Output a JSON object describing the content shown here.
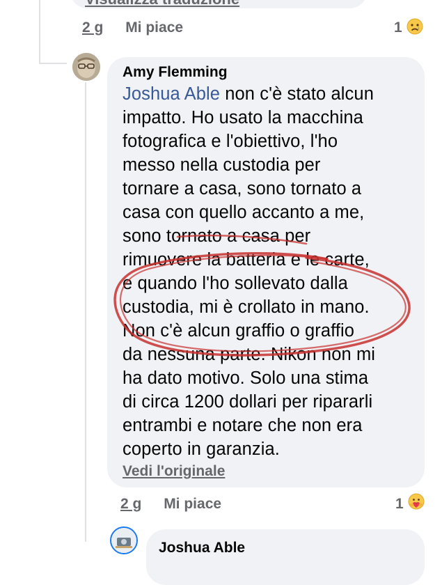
{
  "previous_comment": {
    "translation_link": "Visualizza traduzione",
    "time": "2 g",
    "like_label": "Mi piace",
    "reaction_count": "1",
    "reaction_icon": "sad-face-icon"
  },
  "comment": {
    "author": "Amy Flemming",
    "mention": "Joshua Able",
    "text": " non c'è stato alcun\nimpatto. Ho usato la macchina\nfotografica e l'obiettivo, l'ho\nmesso nella custodia per\ntornare a casa, sono tornato a\ncasa con quello accanto a me,\nsono tornato a casa per\nrimuovere la batteria e le carte,\ne quando l'ho sollevato dalla\ncustodia, mi è crollato in mano.\nNon c'è alcun graffio o graffio\nda nessuna parte. Nikon non mi\nha dato motivo. Solo una stima\ndi circa 1200 dollari per ripararli\nentrambi e notare che non era\ncoperto in garanzia.",
    "see_original": "Vedi l'originale",
    "time": "2 g",
    "like_label": "Mi piace",
    "reaction_count": "1",
    "reaction_icon": "hug-care-icon",
    "annotation_color": "#c8312f"
  },
  "reply": {
    "author": "Joshua Able"
  }
}
